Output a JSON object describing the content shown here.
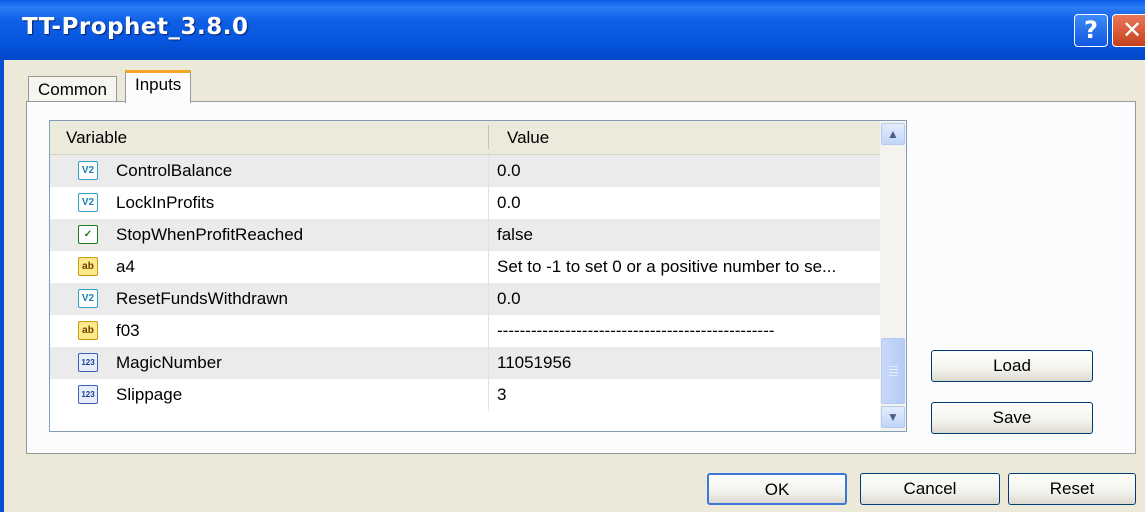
{
  "window": {
    "title": "TT-Prophet_3.8.0",
    "help_glyph": "?",
    "close_glyph": "✕"
  },
  "tabs": [
    {
      "label": "Common"
    },
    {
      "label": "Inputs",
      "active": true
    }
  ],
  "grid": {
    "columns": {
      "variable": "Variable",
      "value": "Value"
    },
    "rows": [
      {
        "icon": "double-icon",
        "icon_text": "V2",
        "name": "ControlBalance",
        "value": "0.0"
      },
      {
        "icon": "double-icon",
        "icon_text": "V2",
        "name": "LockInProfits",
        "value": "0.0"
      },
      {
        "icon": "bool-icon",
        "icon_text": "✓",
        "name": "StopWhenProfitReached",
        "value": "false"
      },
      {
        "icon": "string-icon",
        "icon_text": "ab",
        "name": "a4",
        "value": "Set to -1 to set 0 or a positive number to se..."
      },
      {
        "icon": "double-icon",
        "icon_text": "V2",
        "name": "ResetFundsWithdrawn",
        "value": "0.0"
      },
      {
        "icon": "string-icon",
        "icon_text": "ab",
        "name": "f03",
        "value": "-------------------------------------------------"
      },
      {
        "icon": "integer-icon",
        "icon_text": "123",
        "name": "MagicNumber",
        "value": "11051956"
      },
      {
        "icon": "integer-icon",
        "icon_text": "123",
        "name": "Slippage",
        "value": "3"
      }
    ]
  },
  "buttons": {
    "load": "Load",
    "save": "Save",
    "ok": "OK",
    "cancel": "Cancel",
    "reset": "Reset"
  }
}
